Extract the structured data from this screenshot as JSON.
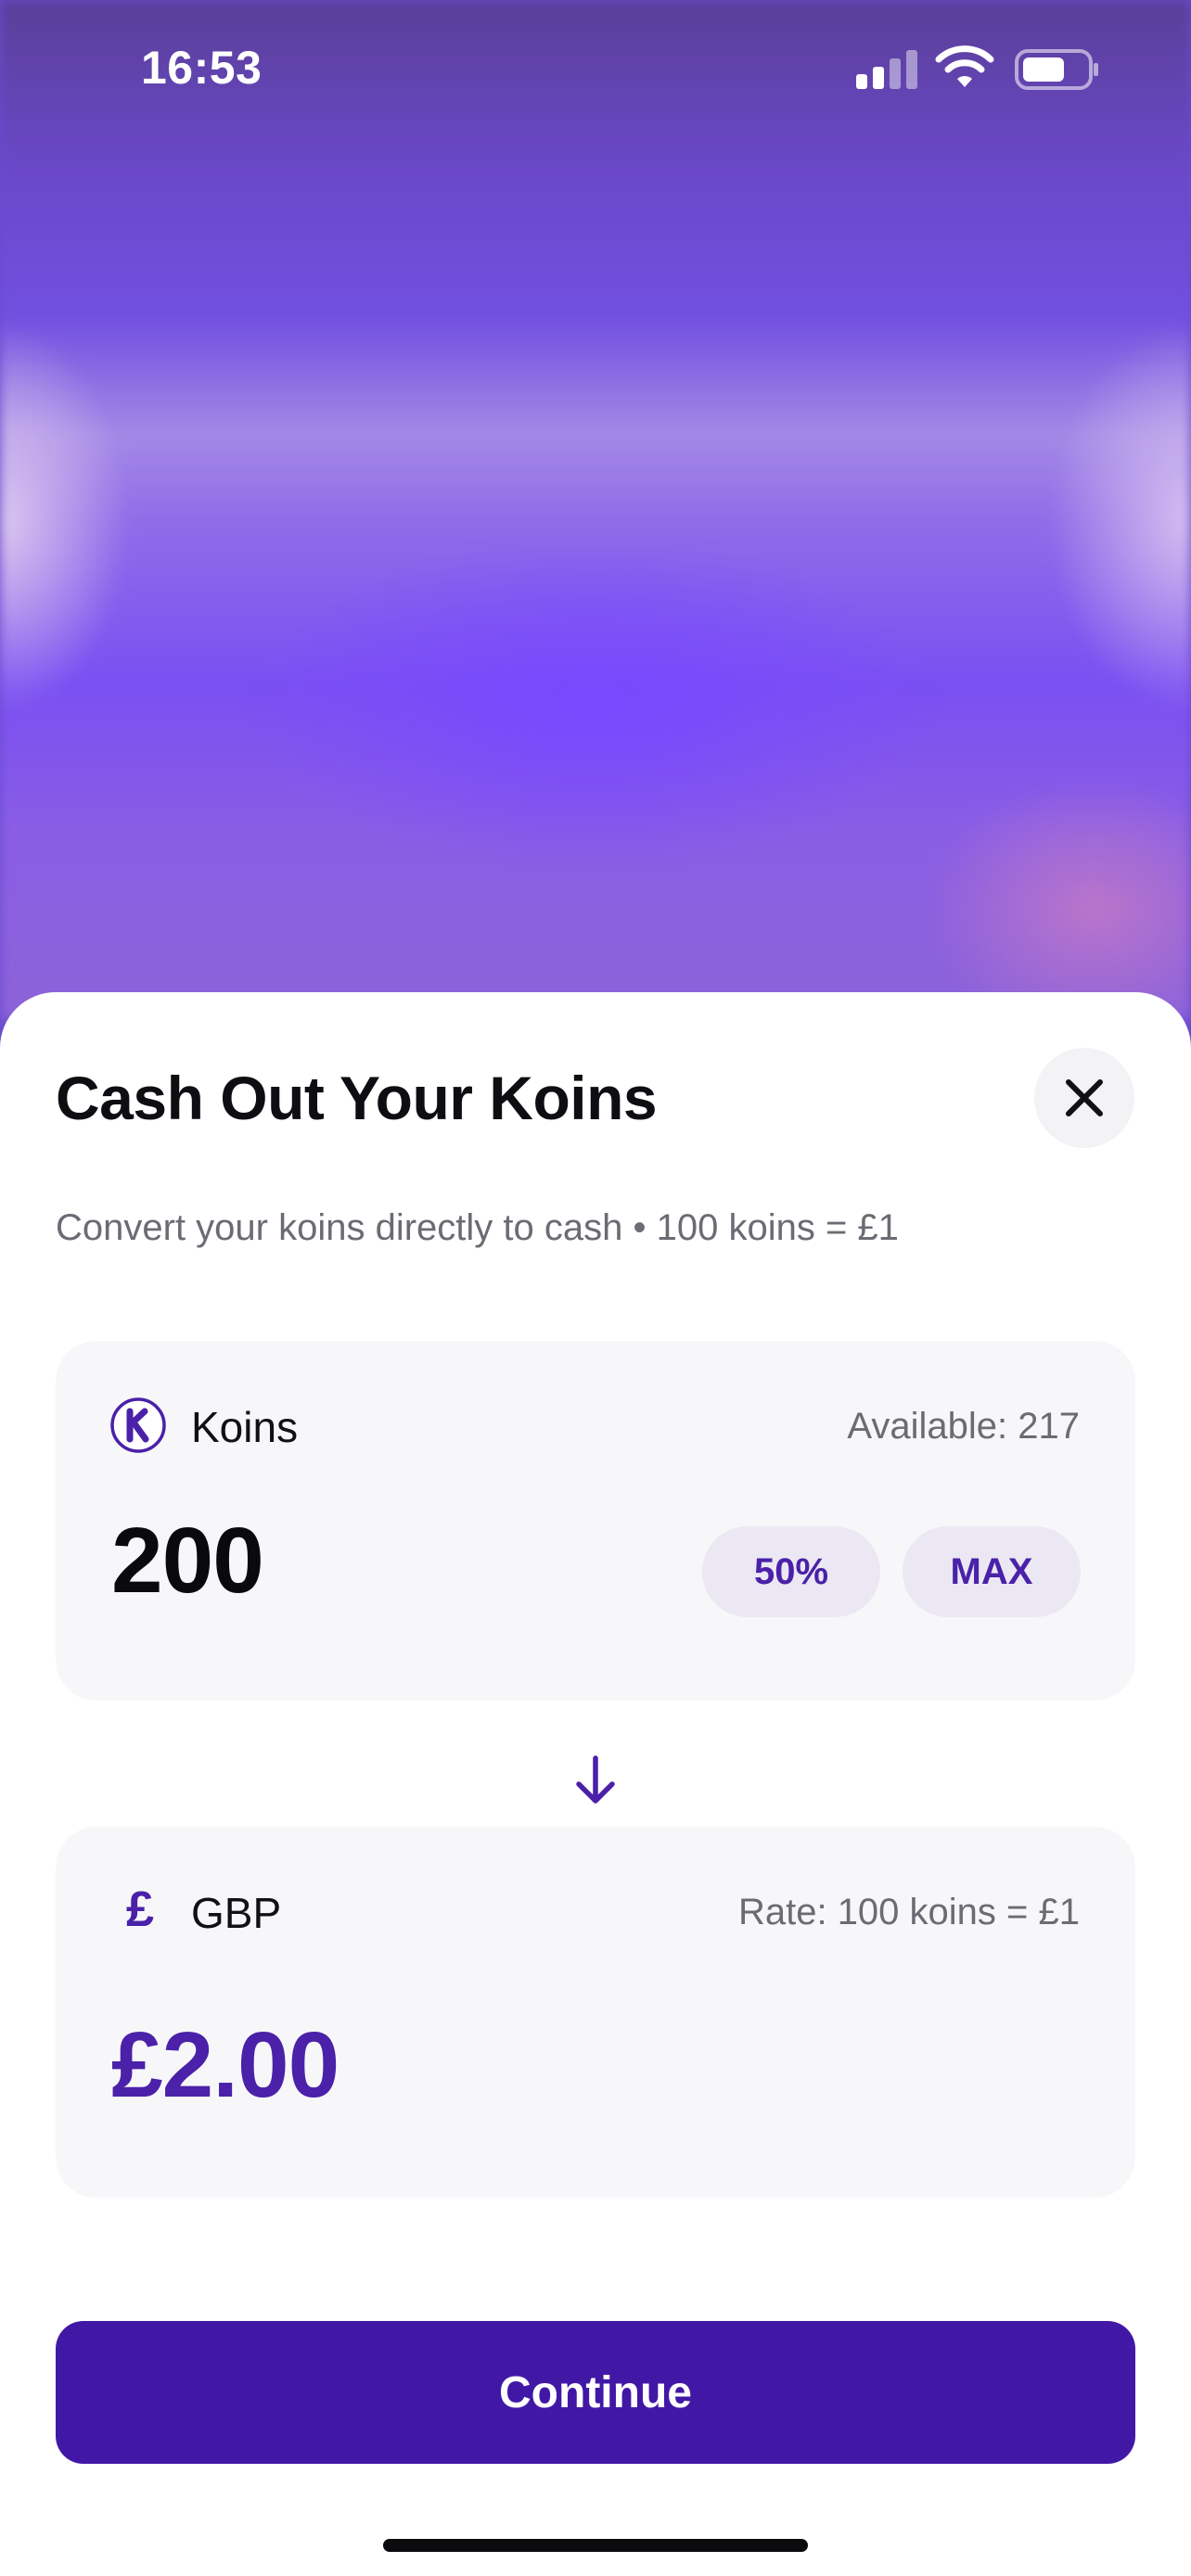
{
  "status_bar": {
    "time": "16:53",
    "icons": [
      "signal-icon",
      "wifi-icon",
      "battery-icon"
    ]
  },
  "sheet": {
    "title": "Cash Out Your Koins",
    "close_icon": "close-icon",
    "subtitle": "Convert your koins directly to cash • 100 koins = £1"
  },
  "from_card": {
    "icon": "koin-icon",
    "label": "Koins",
    "available": "Available: 217",
    "amount": "200",
    "chips": [
      "50%",
      "MAX"
    ]
  },
  "arrow_icon": "arrow-down-icon",
  "to_card": {
    "icon_glyph": "£",
    "label": "GBP",
    "rate": "Rate: 100 koins = £1",
    "amount": "£2.00"
  },
  "continue_label": "Continue",
  "colors": {
    "accent": "#4118a6",
    "accent_text": "#4a21a8",
    "card_bg": "#f7f7f9",
    "chip_bg": "#ebe8f3"
  }
}
